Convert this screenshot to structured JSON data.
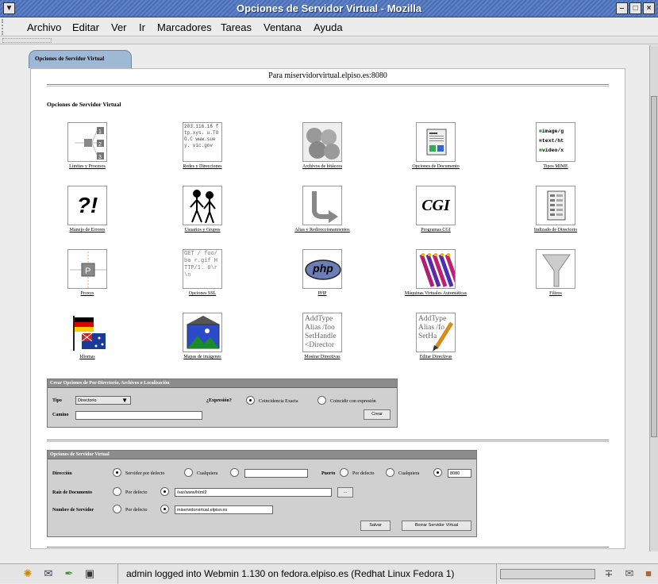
{
  "window": {
    "title": "Opciones de Servidor Virtual - Mozilla"
  },
  "menu": [
    "Archivo",
    "Editar",
    "Ver",
    "Ir",
    "Marcadores",
    "Tareas",
    "Ventana",
    "Ayuda"
  ],
  "page": {
    "tab": "Opciones de Servidor Virtual",
    "header": "Para miservidorvirtual.elpiso.es:8080",
    "section_title": "Opciones de Servidor Virtual",
    "icons": [
      "Límites y Procesos",
      "Redes y Direcciones",
      "Archivos de bitácora",
      "Opciones de Documento",
      "Tipos MIME",
      "Manejo de Errores",
      "Usuarios y Grupos",
      "Alias y Redireccionamientos",
      "Programas CGI",
      "Indizado de Directorio",
      "Proxys",
      "Opciones SSL",
      "PHP",
      "Máquinas Virtuales Automáticas",
      "Filtros",
      "Idiomas",
      "Mapas de imágenes",
      "Mostrar Directivas",
      "Editar Directivas"
    ],
    "icon_glyphs": {
      "net": "203.116.16  ftp.xys.  u.TOO.C  www.suey.  vic.gov",
      "mime": [
        "image/g",
        "text/ht",
        "video/x"
      ],
      "errors": "?!",
      "cgi": "CGI",
      "ssl": "GET /  foo/ba  r.gif H  TTP/1.  0\\r\\n",
      "php": "php",
      "show": [
        "AddType",
        "Alias /foo",
        "SetHandle",
        "<Director"
      ],
      "edit": [
        "AddType",
        "Alias /fo",
        "SetHa"
      ]
    }
  },
  "create_form": {
    "title": "Crear Opciones de Por-Directorio, Archivos o Localización",
    "type_label": "Tipo",
    "type_value": "Directorio",
    "regex_label": "¿Expresión?",
    "opt_exact": "Coincidencia Exacta",
    "opt_regex": "Coincidir con expresión",
    "path_label": "Camino",
    "path_value": "",
    "create_button": "Crear"
  },
  "vs_form": {
    "title": "Opciones de Servidor Virtual",
    "address_label": "Dirección",
    "addr_default": "Servidor por defecto",
    "addr_any": "Cualquiera",
    "address_value": "",
    "port_label": "Puerto",
    "port_default": "Por defecto",
    "port_any": "Cualquiera",
    "port_value": "8080",
    "docroot_label": "Raíz de Documento",
    "docroot_default": "Por defecto",
    "docroot_value": "/var/www/html2",
    "browse_button": "...",
    "servername_label": "Nombre de Servidor",
    "servername_default": "Por defecto",
    "servername_value": "miservidorvirtual.elpiso.es",
    "save_button": "Salvar",
    "delete_button": "Borrar Servidor Virtual"
  },
  "status_text": "admin logged into Webmin 1.130 on fedora.elpiso.es (Redhat Linux Fedora 1)",
  "colors": {
    "titlebar": "#4b6fb7",
    "tab": "#9fb8d6",
    "panel_header": "#8c8c8c"
  }
}
